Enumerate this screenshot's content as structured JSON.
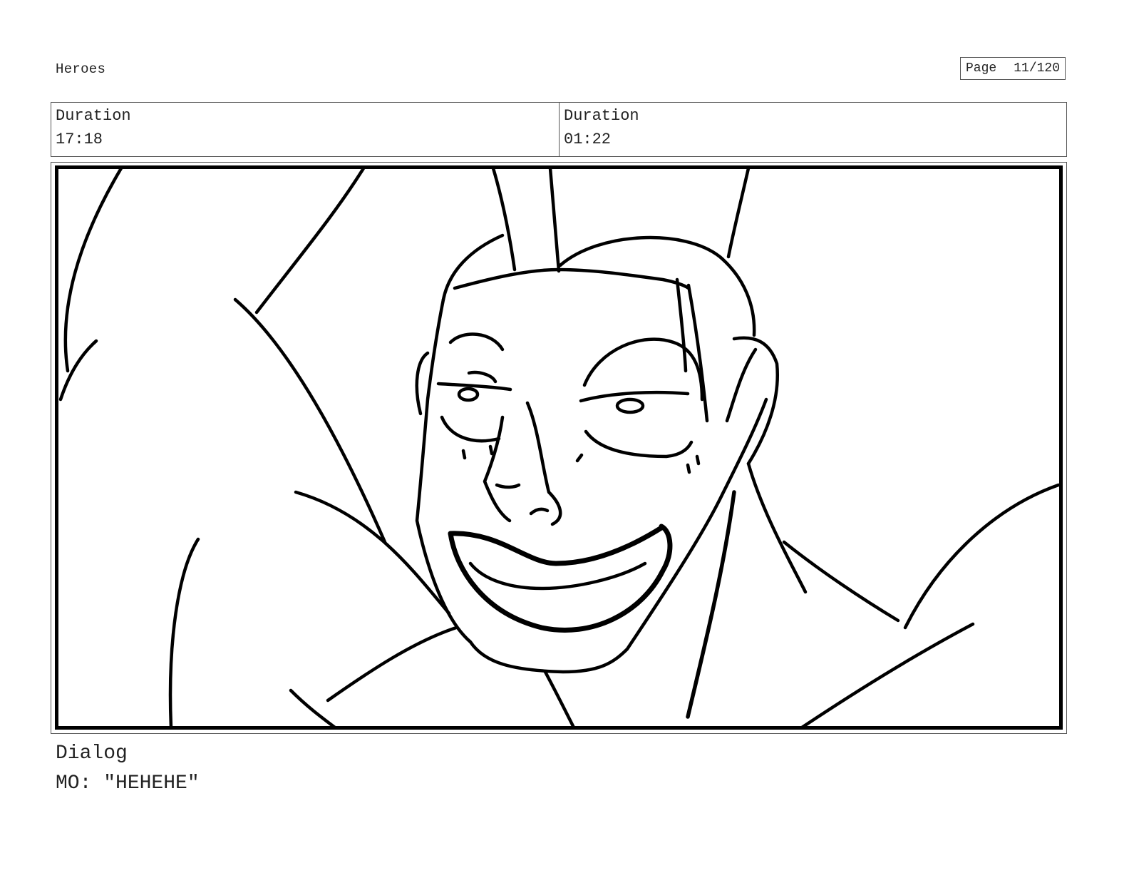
{
  "header": {
    "project_title": "Heroes",
    "page_label": "Page",
    "page_number": "11/120"
  },
  "durations": [
    {
      "label": "Duration",
      "value": "17:18"
    },
    {
      "label": "Duration",
      "value": "01:22"
    }
  ],
  "panel": {
    "subject": "storyboard-sketch-laughing-character"
  },
  "dialog": {
    "label": "Dialog",
    "text": "MO: \"HEHEHE\""
  }
}
